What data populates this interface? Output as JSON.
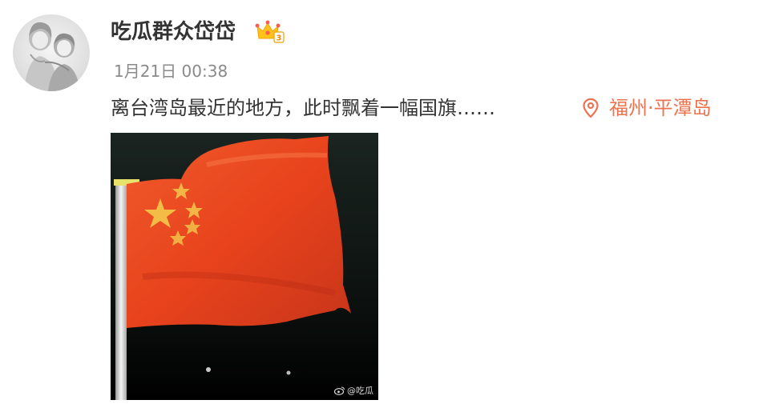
{
  "post": {
    "user": {
      "name": "吃瓜群众岱岱",
      "avatar_icon": "anime-couple-avatar",
      "badge_icon": "vip-crown-icon",
      "badge_level": "3"
    },
    "timestamp": "1月21日 00:38",
    "text": "离台湾岛最近的地方，此时飘着一幅国旗……",
    "location": {
      "icon": "location-pin-icon",
      "name": "福州·平潭岛",
      "color": "#eb7350"
    },
    "photo": {
      "subject_icon": "national-flag-image",
      "watermark": "@吃瓜"
    }
  }
}
